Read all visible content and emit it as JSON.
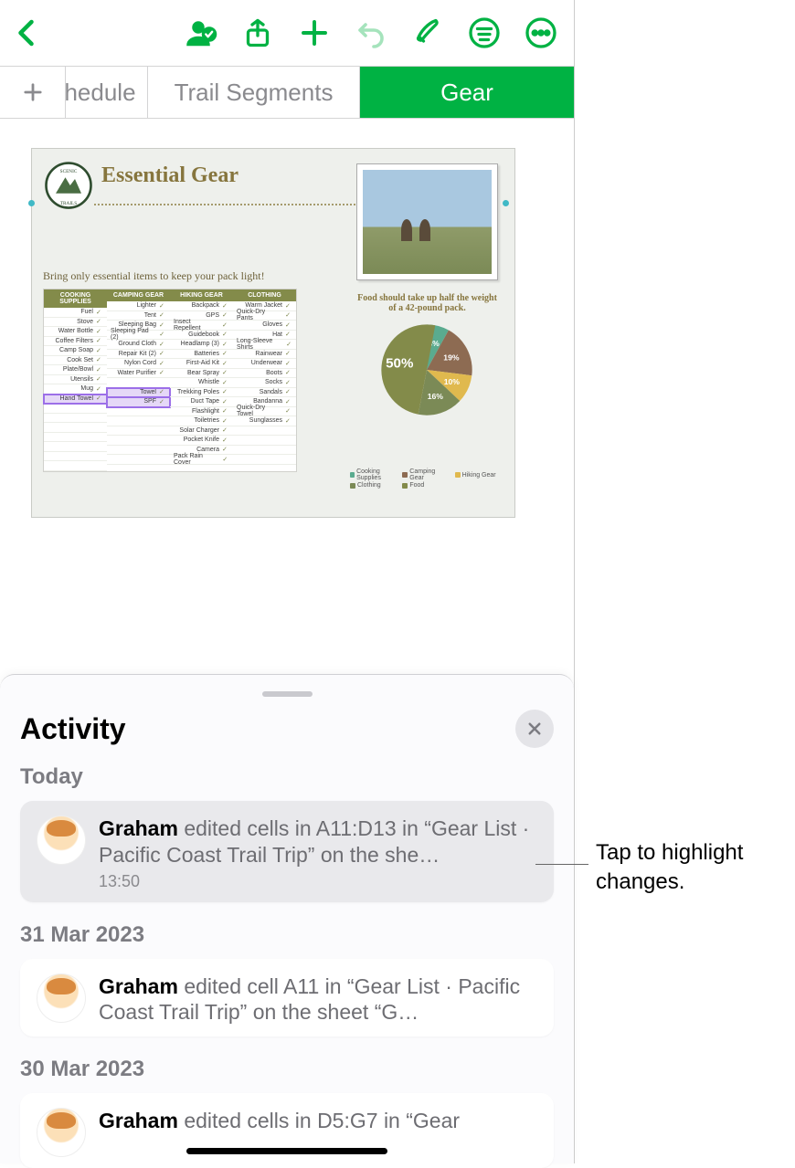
{
  "tabs": {
    "schedule": "hedule",
    "segments": "Trail Segments",
    "gear": "Gear"
  },
  "sheet": {
    "title": "Essential Gear",
    "subtitle": "Bring only essential items to keep your pack light!",
    "photo_caption": "Food should take up half the weight of a 42-pound pack.",
    "columns": [
      "COOKING SUPPLIES",
      "CAMPING GEAR",
      "HIKING GEAR",
      "CLOTHING"
    ],
    "cooking": [
      "Fuel",
      "Stove",
      "Water Bottle",
      "Coffee Filters",
      "Camp Soap",
      "Cook Set",
      "Plate/Bowl",
      "Utensils",
      "Mug",
      "Hand Towel"
    ],
    "camping": [
      "Lighter",
      "Tent",
      "Sleeping Bag",
      "Sleeping Pad (2)",
      "Ground Cloth",
      "Repair Kit (2)",
      "Nylon Cord",
      "Water Purifier",
      "",
      "Towel",
      "SPF"
    ],
    "hiking": [
      "Backpack",
      "GPS",
      "Insect Repellent",
      "Guidebook",
      "Headlamp (3)",
      "Batteries",
      "First-Aid Kit",
      "Bear Spray",
      "Whistle",
      "Trekking Poles",
      "Duct Tape",
      "Flashlight",
      "Toiletries",
      "Solar Charger",
      "Pocket Knife",
      "Camera",
      "Pack Rain Cover"
    ],
    "clothing": [
      "Warm Jacket",
      "Quick-Dry Pants",
      "Gloves",
      "Hat",
      "Long-Sleeve Shirts",
      "Rainwear",
      "Underwear",
      "Boots",
      "Socks",
      "Sandals",
      "Bandanna",
      "Quick-Dry Towel",
      "Sunglasses"
    ]
  },
  "chart_data": {
    "type": "pie",
    "legend": [
      "Cooking Supplies",
      "Camping Gear",
      "Hiking Gear",
      "Clothing",
      "Food"
    ],
    "values": [
      8,
      19,
      10,
      16,
      50
    ],
    "labels": [
      "8%",
      "19%",
      "10%",
      "16%",
      "50%"
    ],
    "colors": [
      "#5aab8f",
      "#8d6b52",
      "#e0b94e",
      "#7b8a56",
      "#838b4a"
    ]
  },
  "activity": {
    "title": "Activity",
    "groups": [
      {
        "label": "Today",
        "entries": [
          {
            "user": "Graham",
            "text": "edited cells in A11:D13 in “Gear List · Pacific Coast Trail Trip” on the she…",
            "time": "13:50",
            "selected": true
          }
        ]
      },
      {
        "label": "31 Mar 2023",
        "entries": [
          {
            "user": "Graham",
            "text": "edited cell A11 in “Gear List · Pacific Coast Trail Trip” on the sheet “G…",
            "selected": false
          }
        ]
      },
      {
        "label": "30 Mar 2023",
        "entries": [
          {
            "user": "Graham",
            "text": "edited cells in D5:G7 in “Gear",
            "selected": false
          }
        ]
      }
    ]
  },
  "callout": "Tap to highlight changes."
}
